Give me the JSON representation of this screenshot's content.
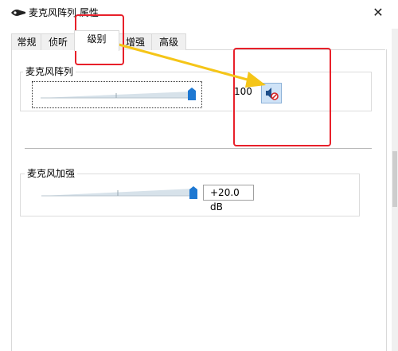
{
  "window": {
    "title": "麦克风阵列 属性",
    "close_symbol": "✕"
  },
  "tabs": [
    {
      "label": "常规",
      "active": false
    },
    {
      "label": "侦听",
      "active": false
    },
    {
      "label": "级别",
      "active": true
    },
    {
      "label": "增强",
      "active": false
    },
    {
      "label": "高级",
      "active": false
    }
  ],
  "mic_array": {
    "group_label": "麦克风阵列",
    "value": "100",
    "level_fraction": 1.0,
    "mute_icon": "speaker-muted-icon"
  },
  "mic_boost": {
    "group_label": "麦克风加强",
    "value": "+20.0 dB",
    "level_fraction": 1.0
  },
  "colors": {
    "annotation_red": "#e8202a",
    "annotation_arrow": "#f5c518",
    "thumb_blue": "#1e78d2"
  }
}
